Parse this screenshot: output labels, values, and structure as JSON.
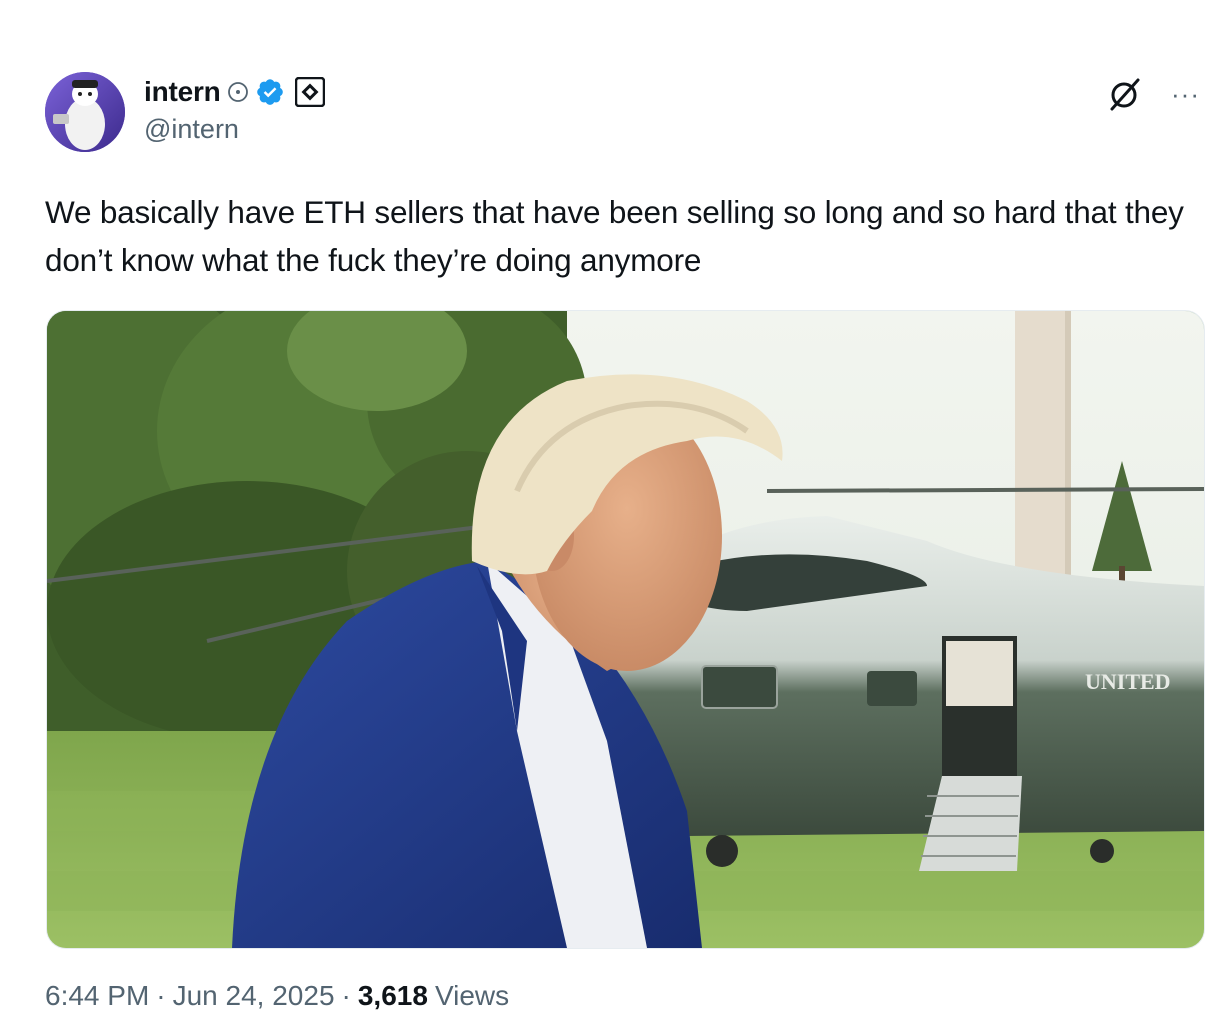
{
  "author": {
    "display_name": "intern",
    "handle": "@intern",
    "verified": true
  },
  "tweet": {
    "text": "We basically have ETH sellers that have been selling so long and so hard that they don’t know what the fuck they’re doing anymore",
    "media_caption_text": "UNITED"
  },
  "meta": {
    "time": "6:44 PM",
    "separator": "·",
    "date": "Jun 24, 2025",
    "views_count": "3,618",
    "views_label": "Views"
  },
  "icons": {
    "more": "···",
    "grok": "slashed-circle-icon",
    "verified": "verified-badge-icon",
    "affiliate": "affiliate-badge-icon",
    "clock": "clock-icon"
  },
  "colors": {
    "verified_blue": "#1d9bf0",
    "text": "#0f1419",
    "secondary_text": "#536471"
  }
}
